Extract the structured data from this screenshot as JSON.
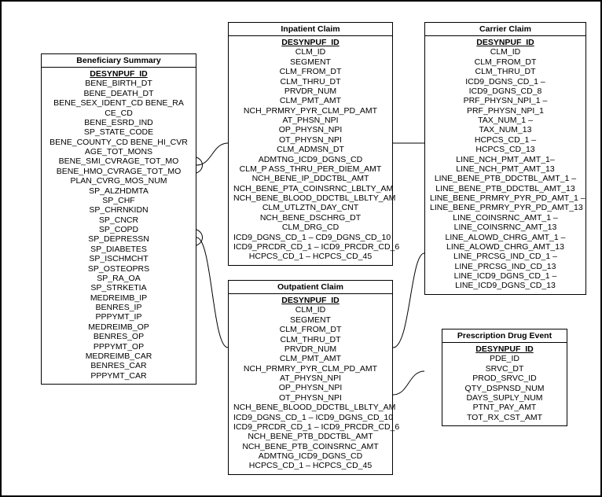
{
  "entities": {
    "beneficiary": {
      "title": "Beneficiary Summary",
      "pk": "DESYNPUF_ID",
      "fields": [
        "BENE_BIRTH_DT",
        "BENE_DEATH_DT",
        "BENE_SEX_IDENT_CD BENE_RA",
        "CE_CD",
        "BENE_ESRD_IND",
        "SP_STATE_CODE",
        "BENE_COUNTY_CD BENE_HI_CVR",
        "AGE_TOT_MONS",
        "BENE_SMI_CVRAGE_TOT_MO",
        "BENE_HMO_CVRAGE_TOT_MO",
        "PLAN_CVRG_MOS_NUM",
        "SP_ALZHDMTA",
        "SP_CHF",
        "SP_CHRNKIDN",
        "SP_CNCR",
        "SP_COPD",
        "SP_DEPRESSN",
        "SP_DIABETES",
        "SP_ISCHMCHT",
        "SP_OSTEOPRS",
        "SP_RA_OA",
        "SP_STRKETIA",
        "MEDREIMB_IP",
        "BENRES_IP",
        "PPPYMT_IP",
        "MEDREIMB_OP",
        "BENRES_OP",
        "PPPYMT_OP",
        "MEDREIMB_CAR",
        "BENRES_CAR",
        "PPPYMT_CAR"
      ]
    },
    "inpatient": {
      "title": "Inpatient Claim",
      "pk": "DESYNPUF_ID",
      "fields": [
        "CLM_ID",
        "SEGMENT",
        "CLM_FROM_DT",
        "CLM_THRU_DT",
        "PRVDR_NUM",
        "CLM_PMT_AMT",
        "NCH_PRMRY_PYR_CLM_PD_AMT",
        "AT_PHSN_NPI",
        "OP_PHYSN_NPI",
        "OT_PHYSN_NPI",
        "CLM_ADMSN_DT",
        "ADMTNG_ICD9_DGNS_CD",
        "CLM_P ASS_THRU_PER_DIEM_AMT",
        "NCH_BENE_IP_DDCTBL_AMT",
        "NCH_BENE_PTA_COINSRNC_LBLTY_AM",
        "NCH_BENE_BLOOD_DDCTBL_LBLTY_AM",
        "CLM_UTLZTN_DAY_CNT",
        "NCH_BENE_DSCHRG_DT",
        "CLM_DRG_CD",
        "ICD9_DGNS_CD_1 – CD9_DGNS_CD_10",
        "ICD9_PRCDR_CD_1 – ICD9_PRCDR_CD_6",
        "HCPCS_CD_1 – HCPCS_CD_45"
      ]
    },
    "outpatient": {
      "title": "Outpatient Claim",
      "pk": "DESYNPUF_ID",
      "fields": [
        "CLM_ID",
        "SEGMENT",
        "CLM_FROM_DT",
        "CLM_THRU_DT",
        "PRVDR_NUM",
        "CLM_PMT_AMT",
        "NCH_PRMRY_PYR_CLM_PD_AMT",
        "AT_PHYSN_NPI",
        "OP_PHYSN_NPI",
        "OT_PHYSN_NPI",
        "NCH_BENE_BLOOD_DDCTBL_LBLTY_AM",
        "ICD9_DGNS_CD_1 – ICD9_DGNS_CD_10",
        "ICD9_PRCDR_CD_1 – ICD9_PRCDR_CD_6",
        "NCH_BENE_PTB_DDCTBL_AMT",
        "NCH_BENE_PTB_COINSRNC_AMT",
        "ADMTNG_ICD9_DGNS_CD",
        "HCPCS_CD_1 – HCPCS_CD_45"
      ]
    },
    "carrier": {
      "title": "Carrier Claim",
      "pk": "DESYNPUF_ID",
      "fields": [
        "CLM_ID",
        "CLM_FROM_DT",
        "CLM_THRU_DT",
        "ICD9_DGNS_CD_1 –",
        "ICD9_DGNS_CD_8",
        "PRF_PHYSN_NPI_1 –",
        "PRF_PHYSN_NPI_1",
        "TAX_NUM_1 –",
        "TAX_NUM_13",
        "HCPCS_CD_1 –",
        "HCPCS_CD_13",
        "LINE_NCH_PMT_AMT_1–",
        "LINE_NCH_PMT_AMT_13",
        "LINE_BENE_PTB_DDCTBL_AMT_1 –",
        "LINE_BENE_PTB_DDCTBL_AMT_13",
        "LINE_BENE_PRMRY_PYR_PD_AMT_1 –",
        "LINE_BENE_PRMRY_PYR_PD_AMT_13",
        "LINE_COINSRNC_AMT_1 –",
        "LINE_COINSRNC_AMT_13",
        "LINE_ALOWD_CHRG_AMT_1 –",
        "LINE_ALOWD_CHRG_AMT_13",
        "LINE_PRCSG_IND_CD_1 –",
        "LINE_PRCSG_IND_CD_13",
        "LINE_ICD9_DGNS_CD_1 –",
        "LINE_ICD9_DGNS_CD_13"
      ]
    },
    "rx": {
      "title": "Prescription Drug Event",
      "pk": "DESYNPUF_ID",
      "fields": [
        "PDE_ID",
        "SRVC_DT",
        "PROD_SRVC_ID",
        "QTY_DSPNSD_NUM",
        "DAYS_SUPLY_NUM",
        "PTNT_PAY_AMT",
        "TOT_RX_CST_AMT"
      ]
    }
  }
}
